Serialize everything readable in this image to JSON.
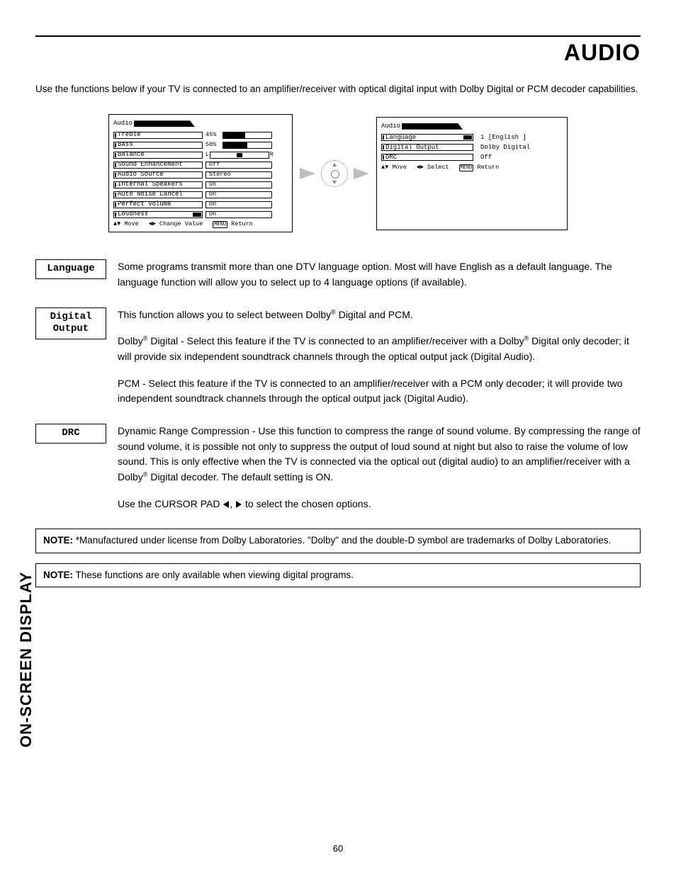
{
  "page": {
    "title": "AUDIO",
    "intro": "Use the functions below if your TV is connected to an amplifier/receiver with optical digital input with Dolby Digital or PCM decoder capabilities.",
    "side_tab": "ON-SCREEN DISPLAY",
    "number": "60"
  },
  "osd_left": {
    "title": "Audio",
    "rows": [
      {
        "label": "Treble",
        "value_text": "45%",
        "type": "percent",
        "pct": 45
      },
      {
        "label": "Bass",
        "value_text": "50%",
        "type": "percent",
        "pct": 50
      },
      {
        "label": "Balance",
        "value_text": "L  R",
        "type": "balance"
      },
      {
        "label": "Sound Enhancement",
        "value_text": "Off",
        "type": "box"
      },
      {
        "label": "Audio Source",
        "value_text": "Stereo",
        "type": "box"
      },
      {
        "label": "Internal Speakers",
        "value_text": "On",
        "type": "box"
      },
      {
        "label": "Auto Noise Cancel",
        "value_text": "On",
        "type": "box"
      },
      {
        "label": "Perfect Volume",
        "value_text": "On",
        "type": "box"
      },
      {
        "label": "Loudness",
        "value_text": "On",
        "type": "box",
        "badge": true
      }
    ],
    "footer": {
      "move": "Move",
      "change": "Change Value",
      "return": "Return"
    }
  },
  "osd_right": {
    "title": "Audio",
    "rows": [
      {
        "label": "Language",
        "value_text": "1 [English ]",
        "badge": true
      },
      {
        "label": "Digital Output",
        "value_text": "Dolby Digital"
      },
      {
        "label": "DRC",
        "value_text": "Off"
      }
    ],
    "footer": {
      "move": "Move",
      "select": "Select",
      "return": "Return"
    }
  },
  "sections": {
    "language": {
      "label": "Language",
      "body": "Some programs transmit more than one DTV language option.  Most will have English as a default language.  The language function will allow you to select up to 4 language options (if available)."
    },
    "digital_output": {
      "label": "Digital\nOutput",
      "p1": "This function allows you to select between Dolby",
      "p1_after": " Digital and PCM.",
      "p2a": "Dolby",
      "p2b": " Digital - Select this feature if the TV is connected to an amplifier/receiver with a Dolby",
      "p2c": " Digital only decoder; it will provide six independent soundtrack channels through the optical output jack (Digital Audio).",
      "p3": "PCM - Select this feature if the TV is connected to an amplifier/receiver with a PCM only decoder; it will provide two independent soundtrack channels through the optical output jack (Digital Audio)."
    },
    "drc": {
      "label": "DRC",
      "p1a": "Dynamic Range Compression - Use this function to compress the range of sound volume. By compressing the range of sound volume, it is possible not only to suppress the output of loud sound at night but also to raise the volume of low sound.  This is only effective when the TV is connected via the optical out (digital audio) to an amplifier/receiver with a Dolby",
      "p1b": " Digital decoder.  The default setting is ON.",
      "p2_pre": "Use the CURSOR PAD ",
      "p2_mid": ", ",
      "p2_post": " to select the chosen options."
    }
  },
  "notes": {
    "n1_label": "NOTE:",
    "n1_body": " *Manufactured under license from Dolby Laboratories.  \"Dolby\" and the double-D symbol are trademarks of Dolby Laboratories.",
    "n2_label": "NOTE:",
    "n2_body": " These functions are only available when viewing digital programs."
  },
  "glyphs": {
    "reg": "®",
    "updown": "▲ ▼",
    "lr": "◄►",
    "menu": "MENU"
  }
}
